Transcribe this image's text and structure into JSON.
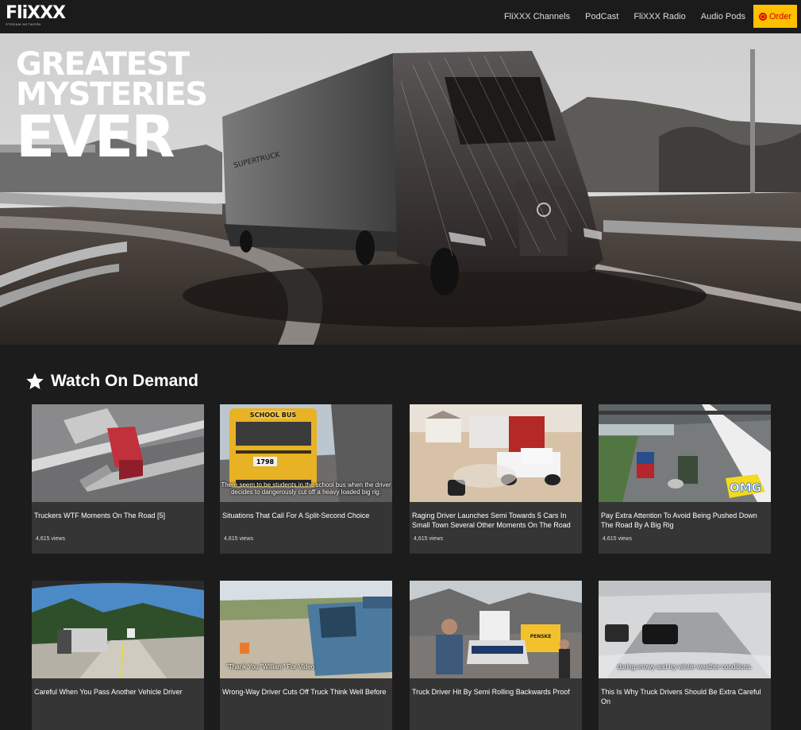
{
  "nav": {
    "logo_text": "FliXXX",
    "logo_sub": "STREAM NETWORK",
    "links": [
      "FliXXX Channels",
      "PodCast",
      "FliXXX Radio",
      "Audio Pods"
    ],
    "order_label": "Order"
  },
  "hero": {
    "line1": "GREATEST",
    "line2": "MYSTERIES",
    "line3": "EVER",
    "truck_text": "SUPERTRUCK"
  },
  "section": {
    "title": "Watch On Demand"
  },
  "videos": [
    {
      "title": "Truckers WTF Moments On The Road [5]",
      "views": "4,615 views",
      "caption": "",
      "badge": ""
    },
    {
      "title": "Situations That Call For A Split-Second Choice",
      "views": "4,615 views",
      "caption": "There seem to be students in the school bus when the driver decides to dangerously cut off a heavy loaded big rig.",
      "badge": "SCHOOL BUS",
      "bus_number": "1798"
    },
    {
      "title": "Raging Driver Launches Semi Towards 5 Cars In Small Town Several Other Moments On The Road",
      "views": "4,615 views",
      "caption": "",
      "badge": ""
    },
    {
      "title": "Pay Extra Attention To Avoid Being Pushed Down The Road By A Big Rig",
      "views": "4,615 views",
      "caption": "",
      "badge": "OMG"
    },
    {
      "title": "Careful When You Pass Another Vehicle Driver",
      "views": "",
      "caption": "",
      "badge": ""
    },
    {
      "title": "Wrong-Way Driver Cuts Off Truck Think Well Before",
      "views": "",
      "caption": "\"Thank You \"William\" For Video",
      "badge": ""
    },
    {
      "title": "Truck Driver Hit By Semi Rolling Backwards Proof",
      "views": "",
      "caption": "",
      "badge": "PENSKE"
    },
    {
      "title": "This Is Why Truck Drivers Should Be Extra Careful On",
      "views": "",
      "caption": "during snowy and icy winter weather conditions.",
      "badge": ""
    }
  ],
  "colors": {
    "accent": "#ffc000",
    "order_text": "#cc0000",
    "card_bg": "#353535",
    "page_bg": "#1c1c1c"
  }
}
